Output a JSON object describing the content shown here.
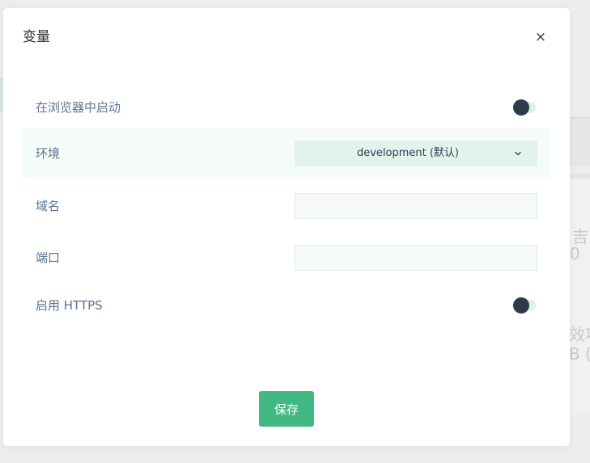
{
  "background": {
    "glyphs": [
      "吉",
      "0",
      "效项",
      "B ("
    ]
  },
  "modal": {
    "title": "变量",
    "close_label": "×",
    "fields": {
      "launch_in_browser": {
        "label": "在浏览器中启动",
        "enabled": false
      },
      "environment": {
        "label": "环境",
        "selected": "development (默认)"
      },
      "domain": {
        "label": "域名",
        "value": ""
      },
      "port": {
        "label": "端口",
        "value": ""
      },
      "enable_https": {
        "label": "启用 HTTPS",
        "enabled": false
      }
    },
    "save_label": "保存"
  },
  "colors": {
    "accent": "#42b983",
    "label_text": "#5c7393",
    "toggle_knob": "#2d3b4d",
    "toggle_track": "#e0f1ea",
    "row_highlight": "#f4fbf8",
    "select_bg": "#e2f3ec"
  },
  "icons": {
    "close": "close-icon",
    "select": "chevron-down-icon"
  }
}
